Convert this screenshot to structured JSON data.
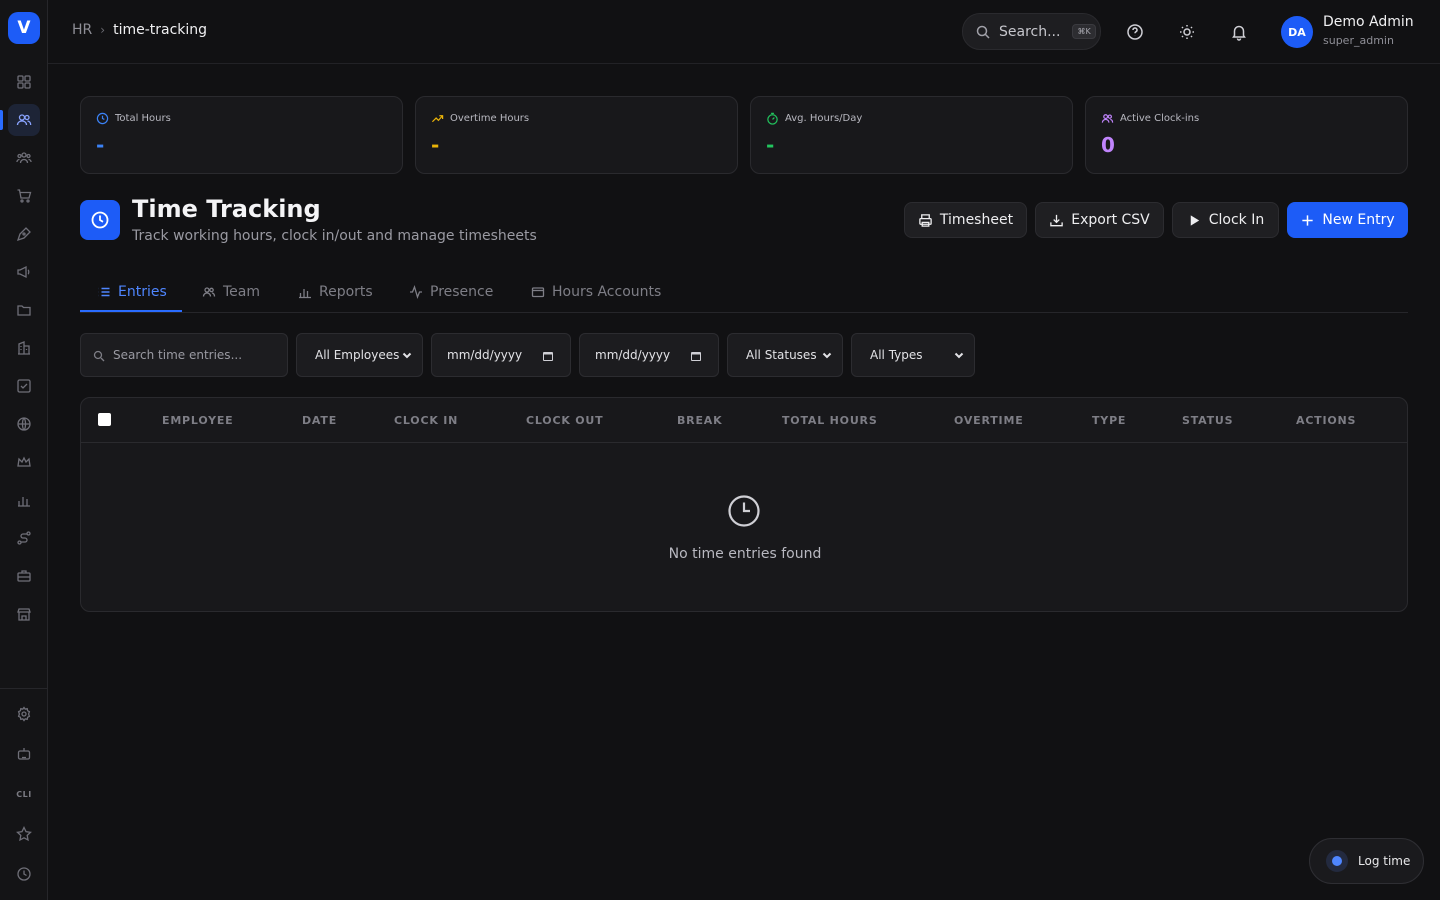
{
  "sidebar": {
    "logo_letter": "V",
    "cli_label": "CLI",
    "top_icons": [
      "dashboard-icon",
      "users-icon",
      "team-icon",
      "cart-icon",
      "pen-tool-icon",
      "megaphone-icon",
      "folder-icon",
      "building-icon",
      "checklist-icon",
      "globe-icon",
      "crown-icon",
      "bar-chart-icon",
      "route-icon",
      "briefcase-icon",
      "store-icon"
    ],
    "bottom_icons": [
      "gear-icon",
      "bot-icon",
      "cli-icon",
      "star-icon",
      "clock-icon"
    ],
    "active_index": 1
  },
  "header": {
    "breadcrumb_root": "HR",
    "breadcrumb_separator": "›",
    "breadcrumb_current": "time-tracking",
    "search_placeholder": "Search...",
    "search_shortcut": "⌘K",
    "user_initials": "DA",
    "user_name": "Demo Admin",
    "user_role": "super_admin"
  },
  "stats": [
    {
      "label": "Total Hours",
      "value": "-",
      "color": "#3b82f6",
      "icon": "clock-icon"
    },
    {
      "label": "Overtime Hours",
      "value": "-",
      "color": "#eab308",
      "icon": "trending-up-icon"
    },
    {
      "label": "Avg. Hours/Day",
      "value": "-",
      "color": "#22c55e",
      "icon": "timer-icon"
    },
    {
      "label": "Active Clock-ins",
      "value": "0",
      "color": "#c084fc",
      "icon": "users-icon"
    }
  ],
  "page": {
    "title": "Time Tracking",
    "subtitle": "Track working hours, clock in/out and manage timesheets"
  },
  "actions": {
    "timesheet": "Timesheet",
    "export_csv": "Export CSV",
    "clock_in": "Clock In",
    "new_entry": "New Entry"
  },
  "tabs": [
    {
      "label": "Entries",
      "active": true
    },
    {
      "label": "Team",
      "active": false
    },
    {
      "label": "Reports",
      "active": false
    },
    {
      "label": "Presence",
      "active": false
    },
    {
      "label": "Hours Accounts",
      "active": false
    }
  ],
  "filters": {
    "search_placeholder": "Search time entries...",
    "employee": "All Employees",
    "date_from": "mm/dd/yyyy",
    "date_to": "mm/dd/yyyy",
    "status": "All Statuses",
    "type": "All Types"
  },
  "table": {
    "columns": [
      "EMPLOYEE",
      "DATE",
      "CLOCK IN",
      "CLOCK OUT",
      "BREAK",
      "TOTAL HOURS",
      "OVERTIME",
      "TYPE",
      "STATUS",
      "ACTIONS"
    ],
    "empty_text": "No time entries found"
  },
  "log_time": {
    "label": "Log time"
  },
  "colors": {
    "accent": "#1d5cf7",
    "tab_active": "#4f86ff"
  }
}
